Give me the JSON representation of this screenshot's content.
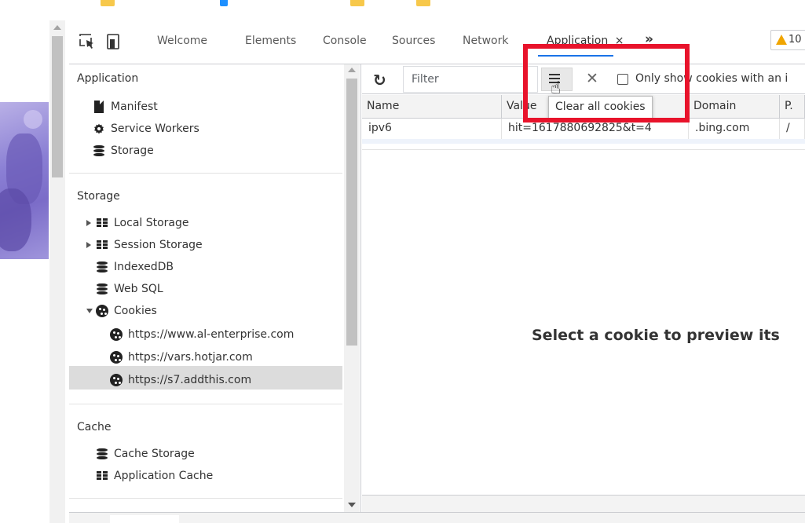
{
  "browser": {
    "tab_hint_colors": [
      "#f7c84b",
      "#1e90ff",
      "#f7c84b",
      "#f7c84b"
    ]
  },
  "toolbar": {
    "tabs": [
      {
        "label": "Welcome"
      },
      {
        "label": "Elements"
      },
      {
        "label": "Console"
      },
      {
        "label": "Sources"
      },
      {
        "label": "Network"
      },
      {
        "label": "Application",
        "close": "×"
      }
    ],
    "more_tabs": "»",
    "warning_count": "10"
  },
  "sidebar": {
    "sections": [
      {
        "title": "Application"
      },
      {
        "title": "Storage"
      },
      {
        "title": "Cache"
      }
    ],
    "application_items": [
      {
        "label": "Manifest",
        "icon": "manifest-icon"
      },
      {
        "label": "Service Workers",
        "icon": "gear-icon"
      },
      {
        "label": "Storage",
        "icon": "database-icon"
      }
    ],
    "storage_items": [
      {
        "label": "Local Storage",
        "icon": "grid-icon"
      },
      {
        "label": "Session Storage",
        "icon": "grid-icon"
      },
      {
        "label": "IndexedDB",
        "icon": "database-icon"
      },
      {
        "label": "Web SQL",
        "icon": "database-icon"
      },
      {
        "label": "Cookies",
        "icon": "cookie-icon"
      }
    ],
    "cookie_origins": [
      {
        "label": "https://www.al-enterprise.com",
        "selected": true
      },
      {
        "label": "https://vars.hotjar.com"
      },
      {
        "label": "https://s7.addthis.com"
      }
    ],
    "cache_items": [
      {
        "label": "Cache Storage",
        "icon": "database-icon"
      },
      {
        "label": "Application Cache",
        "icon": "grid-icon"
      }
    ]
  },
  "cookies": {
    "filter_placeholder": "Filter",
    "clear_tooltip": "Clear all cookies",
    "only_show_label": "Only show cookies with an i",
    "columns": [
      "Name",
      "Value",
      "Domain",
      "P."
    ],
    "rows": [
      {
        "name": "ipv6",
        "value": "hit=1617880692825&t=4",
        "domain": ".bing.com",
        "path": "/"
      }
    ],
    "preview_message": "Select a cookie to preview its"
  },
  "colors": {
    "highlight": "#e8132b",
    "active_tab_underline": "#1a73e8",
    "warning": "#f0a500",
    "selected_row": "#dcdcdc"
  }
}
